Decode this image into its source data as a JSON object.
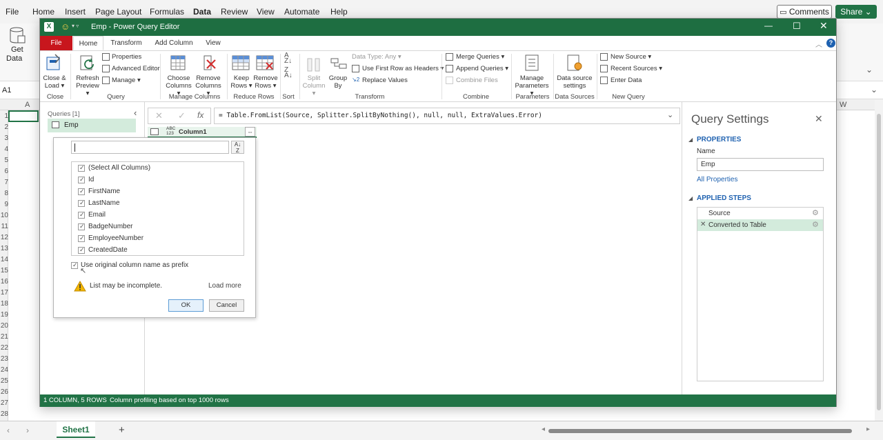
{
  "excel": {
    "menu": [
      "File",
      "Home",
      "Insert",
      "Page Layout",
      "Formulas",
      "Data",
      "Review",
      "View",
      "Automate",
      "Help"
    ],
    "comments_label": "Comments",
    "share_label": "Share",
    "get_data_label_1": "Get",
    "get_data_label_2": "Data",
    "name_box": "A1",
    "col_a": "A",
    "col_w": "W",
    "row_numbers": [
      "1",
      "2",
      "3",
      "4",
      "5",
      "6",
      "7",
      "8",
      "9",
      "10",
      "11",
      "12",
      "13",
      "14",
      "15",
      "16",
      "17",
      "18",
      "19",
      "20",
      "21",
      "22",
      "23",
      "24",
      "25",
      "26",
      "27",
      "28"
    ],
    "sheet_tab": "Sheet1",
    "add_sheet": "+"
  },
  "pq": {
    "title": "Emp - Power Query Editor",
    "tabs": [
      "File",
      "Home",
      "Transform",
      "Add Column",
      "View"
    ],
    "ribbon": {
      "close_load": [
        "Close &",
        "Load"
      ],
      "refresh_preview": [
        "Refresh",
        "Preview"
      ],
      "properties": "Properties",
      "advanced_editor": "Advanced Editor",
      "manage": "Manage",
      "choose_columns": [
        "Choose",
        "Columns"
      ],
      "remove_columns": [
        "Remove",
        "Columns"
      ],
      "keep_rows": [
        "Keep",
        "Rows"
      ],
      "remove_rows": [
        "Remove",
        "Rows"
      ],
      "split_column": [
        "Split",
        "Column"
      ],
      "group_by": [
        "Group",
        "By"
      ],
      "data_type": "Data Type: Any",
      "use_first_row": "Use First Row as Headers",
      "replace_values": "Replace Values",
      "merge_queries": "Merge Queries",
      "append_queries": "Append Queries",
      "combine_files": "Combine Files",
      "manage_parameters": [
        "Manage",
        "Parameters"
      ],
      "data_source_settings": [
        "Data source",
        "settings"
      ],
      "new_source": "New Source",
      "recent_sources": "Recent Sources",
      "enter_data": "Enter Data",
      "groups": [
        "Close",
        "Query",
        "Manage Columns",
        "Reduce Rows",
        "Sort",
        "Transform",
        "Combine",
        "Parameters",
        "Data Sources",
        "New Query"
      ]
    },
    "queries_header": "Queries [1]",
    "query_name": "Emp",
    "formula": "= Table.FromList(Source, Splitter.SplitByNothing(), null, null, ExtraValues.Error)",
    "column_type": "ABC\n123",
    "column_header": "Column1",
    "expand": {
      "search_value": "",
      "columns": [
        "(Select All Columns)",
        "Id",
        "FirstName",
        "LastName",
        "Email",
        "BadgeNumber",
        "EmployeeNumber",
        "CreatedDate"
      ],
      "prefix_label": "Use original column name as prefix",
      "warning": "List may be incomplete.",
      "load_more": "Load more",
      "ok": "OK",
      "cancel": "Cancel"
    },
    "settings": {
      "title": "Query Settings",
      "properties_header": "PROPERTIES",
      "name_label": "Name",
      "name_value": "Emp",
      "all_properties": "All Properties",
      "applied_steps_header": "APPLIED STEPS",
      "steps": [
        "Source",
        "Converted to Table"
      ]
    },
    "status": {
      "count": "1 COLUMN, 5 ROWS",
      "profiling": "Column profiling based on top 1000 rows"
    }
  },
  "colors": {
    "excel_green": "#217346",
    "pq_title": "#1e6e41",
    "file_tab": "#c8161d",
    "accent_blue": "#1e61b0"
  }
}
